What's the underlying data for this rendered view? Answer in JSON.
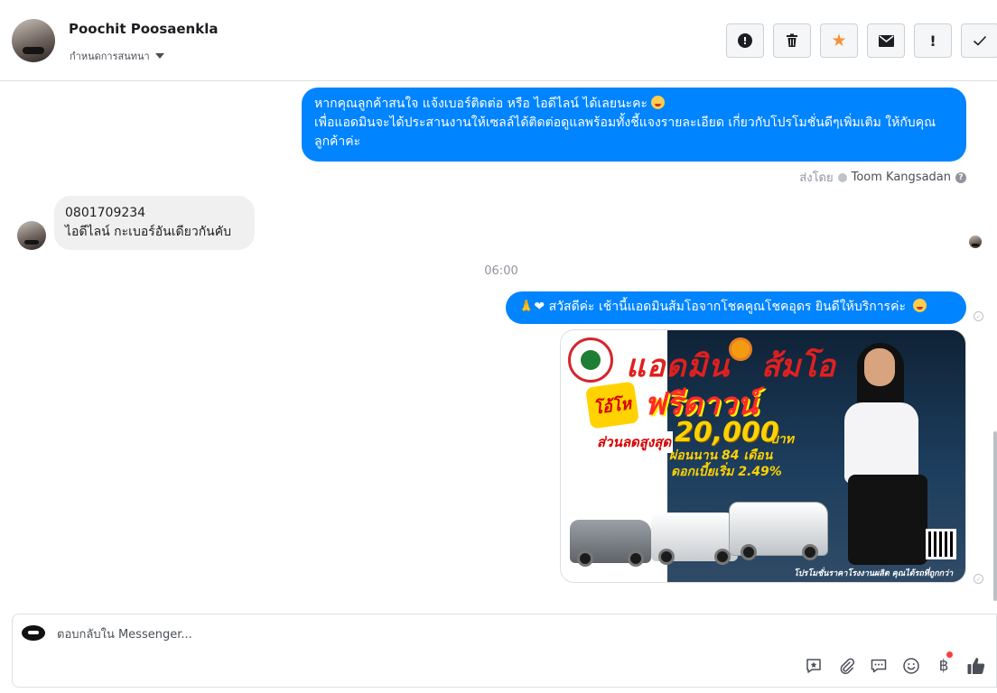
{
  "header": {
    "contact_name": "Poochit Poosaenkla",
    "assign_label": "กำหนดการสนทนา",
    "actions": [
      {
        "icon": "alert-circle-icon",
        "glyph": "!"
      },
      {
        "icon": "trash-icon"
      },
      {
        "icon": "star-icon",
        "glyph": "★",
        "color": "#f7923b"
      },
      {
        "icon": "envelope-icon"
      },
      {
        "icon": "exclamation-icon",
        "glyph": "!"
      },
      {
        "icon": "check-icon",
        "glyph": "✓"
      }
    ]
  },
  "messages": {
    "m1_line1": "หากคุณลูกค้าสนใจ แจ้งเบอร์ติดต่อ หรือ ไอดีไลน์ ได้เลยนะคะ",
    "m1_line2": "เพื่อแอดมินจะได้ประสานงานให้เซลล์ได้ติดต่อดูแลพร้อมทั้งชี้แจงรายละเอียด เกี่ยวกับโปรโมชั่นดีๆเพิ่มเติม ให้กับคุณลูกค้าค่ะ",
    "sent_by_label": "ส่งโดย",
    "sent_by_name": "Toom Kangsadan",
    "m2_line1": "0801709234",
    "m2_line2": "ไอดีไลน์ กะเบอร์อันเดียวกันคับ",
    "timestamp": "06:00",
    "m3_text": "สวัสดีค่ะ เช้านี้แอดมินส้มโอจากโชคคูณโชคอุดร ยินดีให้บริการค่ะ",
    "m3_prefix_emoji": "🙏❤"
  },
  "promo": {
    "title_admin": "แอดมิน",
    "title_name": "ส้มโอ",
    "badge": "โอ้โห",
    "free_down": "ฟรีดาวน์",
    "discount_label": "ส่วนลดสูงสุด",
    "discount_value": "20,000",
    "baht": "บาท",
    "installment": "ผ่อนนาน 84 เดือน",
    "rate": "ดอกเบี้ยเริ่ม 2.49%",
    "footer": "โปรโมชั่นราคาโรงงานผลิต คุณได้รถที่ถูกกว่า"
  },
  "composer": {
    "placeholder": "ตอบกลับใน Messenger...",
    "tools": [
      "saved-reply-icon",
      "attachment-icon",
      "chat-bubble-icon",
      "emoji-icon",
      "baht-payment-icon",
      "like-icon"
    ]
  },
  "colors": {
    "outgoing": "#0084ff",
    "incoming": "#f1f0f0",
    "accent_star": "#f7923b"
  }
}
